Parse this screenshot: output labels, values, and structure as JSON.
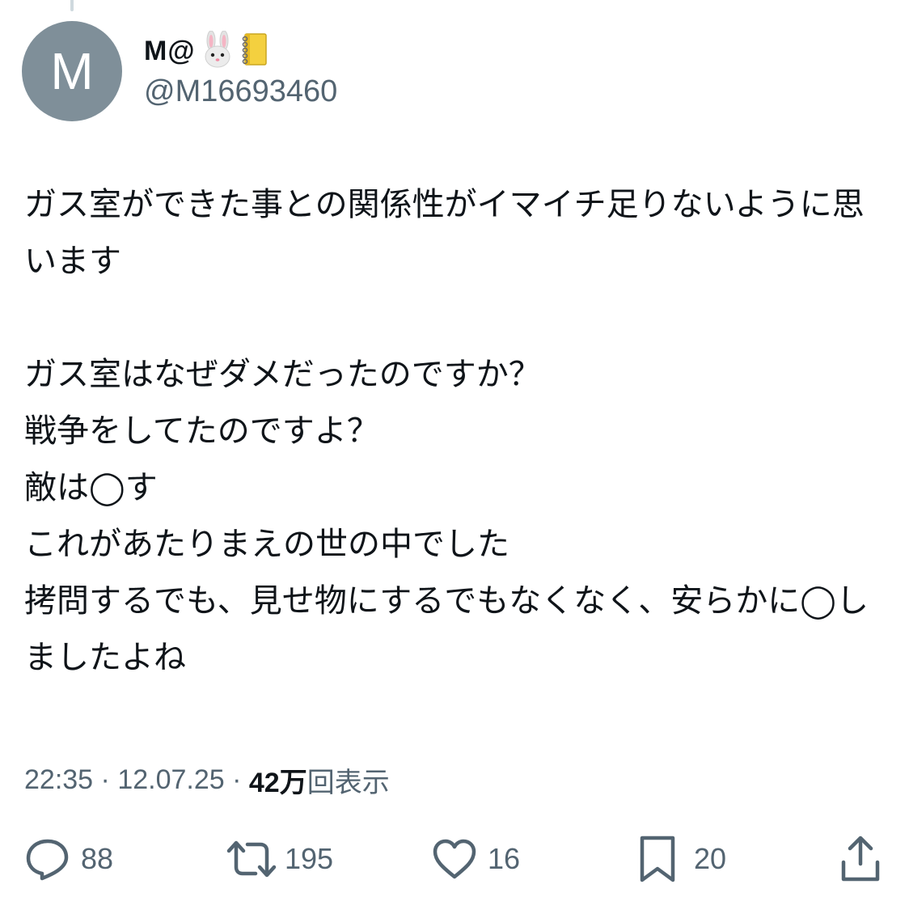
{
  "author": {
    "avatar_letter": "M",
    "display_name": "M@",
    "handle": "@M16693460",
    "badges": [
      "rabbit-face-emoji",
      "notebook-emoji"
    ]
  },
  "tweet": {
    "text": "ガス室ができた事との関係性がイマイチ足りないように思います\n\nガス室はなぜダメだったのですか？\n戦争をしてたのですよ？\n敵は◯す\nこれがあたりまえの世の中でした\n拷問するでも、見せ物にするでもなくなく、安らかに◯しましたよね"
  },
  "meta": {
    "time": "22:35",
    "separator": " · ",
    "date": "12.07.25",
    "views_count": "42万",
    "views_label": "回表示"
  },
  "actions": {
    "reply_count": "88",
    "retweet_count": "195",
    "like_count": "16",
    "bookmark_count": "20"
  },
  "colors": {
    "text_primary": "#0f1419",
    "text_secondary": "#536471",
    "avatar_bg": "#7f8f99",
    "icon_gray": "#536471"
  }
}
